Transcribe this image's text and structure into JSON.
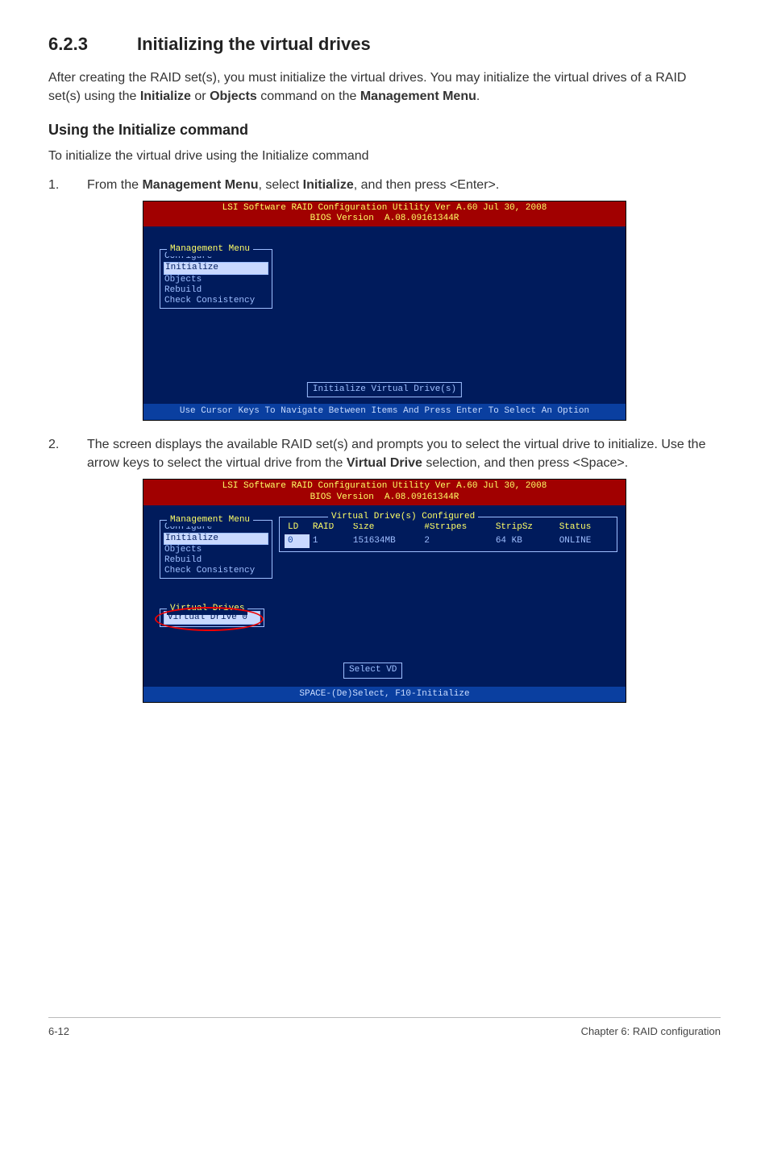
{
  "section": {
    "number": "6.2.3",
    "title": "Initializing the virtual drives"
  },
  "intro": {
    "text_pre": "After creating the RAID set(s), you must initialize the virtual drives. You may initialize the virtual drives of a RAID set(s) using the ",
    "bold1": "Initialize",
    "text_mid1": " or ",
    "bold2": "Objects",
    "text_mid2": " command on the ",
    "bold3": "Management Menu",
    "text_post": "."
  },
  "subheading": "Using the Initialize command",
  "subintro": "To initialize the virtual drive using the Initialize command",
  "step1": {
    "num": "1.",
    "pre": "From the ",
    "bold1": "Management Menu",
    "mid": ", select ",
    "bold2": "Initialize",
    "post": ", and then press <Enter>."
  },
  "step2": {
    "num": "2.",
    "pre": "The screen displays the available RAID set(s) and prompts you to select the virtual drive to initialize. Use the arrow keys to select the virtual drive from the ",
    "bold1": "Virtual Drive",
    "post": " selection, and then press <Space>."
  },
  "bios1": {
    "header_line1": "LSI Software RAID Configuration Utility Ver A.60 Jul 30, 2008",
    "header_line2": "BIOS Version  A.08.09161344R",
    "menu_title": "Management Menu",
    "menu_items": [
      "Configure",
      "Initialize",
      "Objects",
      "Rebuild",
      "Check Consistency"
    ],
    "selected_index": 1,
    "caption": "Initialize Virtual Drive(s)",
    "footer": "Use Cursor Keys To Navigate Between Items And Press Enter To Select An Option"
  },
  "bios2": {
    "header_line1": "LSI Software RAID Configuration Utility Ver A.60 Jul 30, 2008",
    "header_line2": "BIOS Version  A.08.09161344R",
    "menu_title": "Management Menu",
    "menu_items": [
      "Configure",
      "Initialize",
      "Objects",
      "Rebuild",
      "Check Consistency"
    ],
    "selected_index": 1,
    "vd_box_title": "Virtual Drives",
    "vd_item": "Virtual Drive 0",
    "table_title": "Virtual Drive(s) Configured",
    "columns": [
      "LD",
      "RAID",
      "Size",
      "#Stripes",
      "StripSz",
      "Status"
    ],
    "row": {
      "LD": "0",
      "RAID": "1",
      "Size": "151634MB",
      "Stripes": "2",
      "StripSz": "64 KB",
      "Status": "ONLINE"
    },
    "caption": "Select VD",
    "footer": "SPACE-(De)Select,  F10-Initialize"
  },
  "page_footer": {
    "left": "6-12",
    "right": "Chapter 6: RAID configuration"
  }
}
